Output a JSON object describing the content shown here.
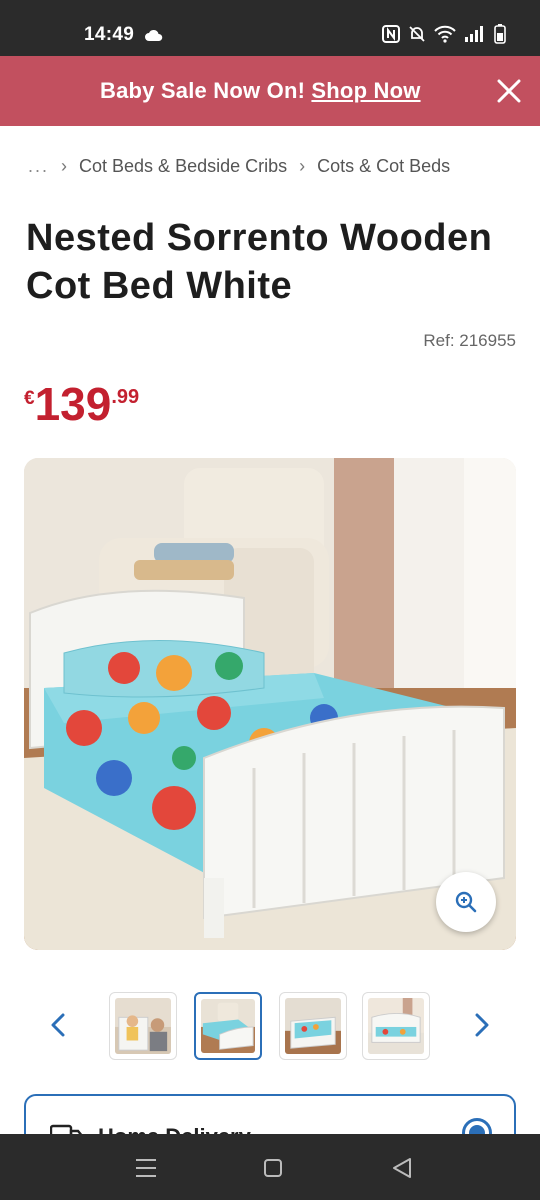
{
  "status_bar": {
    "time": "14:49",
    "icons": [
      "cloud-icon",
      "nfc-icon",
      "mute-icon",
      "wifi-icon",
      "signal-icon",
      "battery-icon"
    ]
  },
  "promo": {
    "text": "Baby Sale Now On!",
    "link": "Shop Now",
    "background": "#c2505f"
  },
  "breadcrumb": {
    "ellipsis": "...",
    "items": [
      "Cot Beds & Bedside Cribs",
      "Cots & Cot Beds"
    ]
  },
  "product": {
    "title": "Nested Sorrento Wooden Cot Bed White",
    "ref": "Ref: 216955",
    "price": {
      "currency": "€",
      "main": "139",
      "cents": ".99",
      "color": "#c3202f"
    }
  },
  "gallery": {
    "thumbnail_count": 4,
    "active_index": 1
  },
  "delivery": {
    "label": "Home Delivery",
    "selected": true,
    "accent": "#2b6fb8"
  }
}
